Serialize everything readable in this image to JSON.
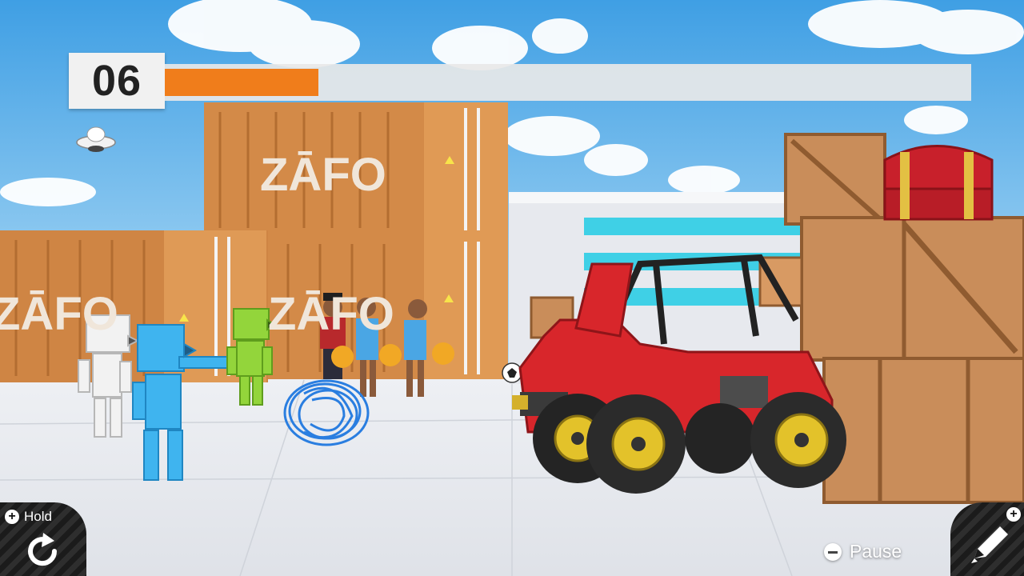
{
  "hud": {
    "timer": "06",
    "progress": 0.19,
    "progress_color": "#f07d1b"
  },
  "controls": {
    "hold": {
      "icon": "plus-button-icon",
      "label": "Hold",
      "action_icon": "rotate-icon"
    },
    "pause": {
      "icon": "minus-button-icon",
      "label": "Pause"
    },
    "edit": {
      "icon": "plus-button-icon",
      "action_icon": "pencil-icon"
    }
  },
  "scene": {
    "container_brand": "ZĀFO",
    "icons": [
      "ufo-icon",
      "treasure-chest-icon",
      "soccer-ball-icon"
    ]
  }
}
